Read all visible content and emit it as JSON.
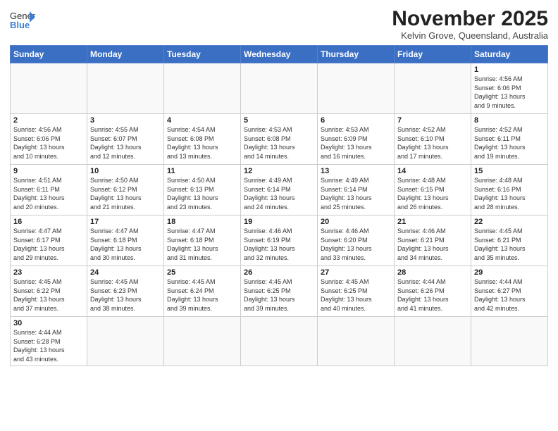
{
  "header": {
    "logo_general": "General",
    "logo_blue": "Blue",
    "month": "November 2025",
    "location": "Kelvin Grove, Queensland, Australia"
  },
  "weekdays": [
    "Sunday",
    "Monday",
    "Tuesday",
    "Wednesday",
    "Thursday",
    "Friday",
    "Saturday"
  ],
  "weeks": [
    [
      {
        "day": "",
        "info": ""
      },
      {
        "day": "",
        "info": ""
      },
      {
        "day": "",
        "info": ""
      },
      {
        "day": "",
        "info": ""
      },
      {
        "day": "",
        "info": ""
      },
      {
        "day": "",
        "info": ""
      },
      {
        "day": "1",
        "info": "Sunrise: 4:56 AM\nSunset: 6:06 PM\nDaylight: 13 hours\nand 9 minutes."
      }
    ],
    [
      {
        "day": "2",
        "info": "Sunrise: 4:56 AM\nSunset: 6:06 PM\nDaylight: 13 hours\nand 10 minutes."
      },
      {
        "day": "3",
        "info": "Sunrise: 4:55 AM\nSunset: 6:07 PM\nDaylight: 13 hours\nand 12 minutes."
      },
      {
        "day": "4",
        "info": "Sunrise: 4:54 AM\nSunset: 6:08 PM\nDaylight: 13 hours\nand 13 minutes."
      },
      {
        "day": "5",
        "info": "Sunrise: 4:53 AM\nSunset: 6:08 PM\nDaylight: 13 hours\nand 14 minutes."
      },
      {
        "day": "6",
        "info": "Sunrise: 4:53 AM\nSunset: 6:09 PM\nDaylight: 13 hours\nand 16 minutes."
      },
      {
        "day": "7",
        "info": "Sunrise: 4:52 AM\nSunset: 6:10 PM\nDaylight: 13 hours\nand 17 minutes."
      },
      {
        "day": "8",
        "info": "Sunrise: 4:52 AM\nSunset: 6:11 PM\nDaylight: 13 hours\nand 19 minutes."
      }
    ],
    [
      {
        "day": "9",
        "info": "Sunrise: 4:51 AM\nSunset: 6:11 PM\nDaylight: 13 hours\nand 20 minutes."
      },
      {
        "day": "10",
        "info": "Sunrise: 4:50 AM\nSunset: 6:12 PM\nDaylight: 13 hours\nand 21 minutes."
      },
      {
        "day": "11",
        "info": "Sunrise: 4:50 AM\nSunset: 6:13 PM\nDaylight: 13 hours\nand 23 minutes."
      },
      {
        "day": "12",
        "info": "Sunrise: 4:49 AM\nSunset: 6:14 PM\nDaylight: 13 hours\nand 24 minutes."
      },
      {
        "day": "13",
        "info": "Sunrise: 4:49 AM\nSunset: 6:14 PM\nDaylight: 13 hours\nand 25 minutes."
      },
      {
        "day": "14",
        "info": "Sunrise: 4:48 AM\nSunset: 6:15 PM\nDaylight: 13 hours\nand 26 minutes."
      },
      {
        "day": "15",
        "info": "Sunrise: 4:48 AM\nSunset: 6:16 PM\nDaylight: 13 hours\nand 28 minutes."
      }
    ],
    [
      {
        "day": "16",
        "info": "Sunrise: 4:47 AM\nSunset: 6:17 PM\nDaylight: 13 hours\nand 29 minutes."
      },
      {
        "day": "17",
        "info": "Sunrise: 4:47 AM\nSunset: 6:18 PM\nDaylight: 13 hours\nand 30 minutes."
      },
      {
        "day": "18",
        "info": "Sunrise: 4:47 AM\nSunset: 6:18 PM\nDaylight: 13 hours\nand 31 minutes."
      },
      {
        "day": "19",
        "info": "Sunrise: 4:46 AM\nSunset: 6:19 PM\nDaylight: 13 hours\nand 32 minutes."
      },
      {
        "day": "20",
        "info": "Sunrise: 4:46 AM\nSunset: 6:20 PM\nDaylight: 13 hours\nand 33 minutes."
      },
      {
        "day": "21",
        "info": "Sunrise: 4:46 AM\nSunset: 6:21 PM\nDaylight: 13 hours\nand 34 minutes."
      },
      {
        "day": "22",
        "info": "Sunrise: 4:45 AM\nSunset: 6:21 PM\nDaylight: 13 hours\nand 35 minutes."
      }
    ],
    [
      {
        "day": "23",
        "info": "Sunrise: 4:45 AM\nSunset: 6:22 PM\nDaylight: 13 hours\nand 37 minutes."
      },
      {
        "day": "24",
        "info": "Sunrise: 4:45 AM\nSunset: 6:23 PM\nDaylight: 13 hours\nand 38 minutes."
      },
      {
        "day": "25",
        "info": "Sunrise: 4:45 AM\nSunset: 6:24 PM\nDaylight: 13 hours\nand 39 minutes."
      },
      {
        "day": "26",
        "info": "Sunrise: 4:45 AM\nSunset: 6:25 PM\nDaylight: 13 hours\nand 39 minutes."
      },
      {
        "day": "27",
        "info": "Sunrise: 4:45 AM\nSunset: 6:25 PM\nDaylight: 13 hours\nand 40 minutes."
      },
      {
        "day": "28",
        "info": "Sunrise: 4:44 AM\nSunset: 6:26 PM\nDaylight: 13 hours\nand 41 minutes."
      },
      {
        "day": "29",
        "info": "Sunrise: 4:44 AM\nSunset: 6:27 PM\nDaylight: 13 hours\nand 42 minutes."
      }
    ],
    [
      {
        "day": "30",
        "info": "Sunrise: 4:44 AM\nSunset: 6:28 PM\nDaylight: 13 hours\nand 43 minutes."
      },
      {
        "day": "",
        "info": ""
      },
      {
        "day": "",
        "info": ""
      },
      {
        "day": "",
        "info": ""
      },
      {
        "day": "",
        "info": ""
      },
      {
        "day": "",
        "info": ""
      },
      {
        "day": "",
        "info": ""
      }
    ]
  ]
}
